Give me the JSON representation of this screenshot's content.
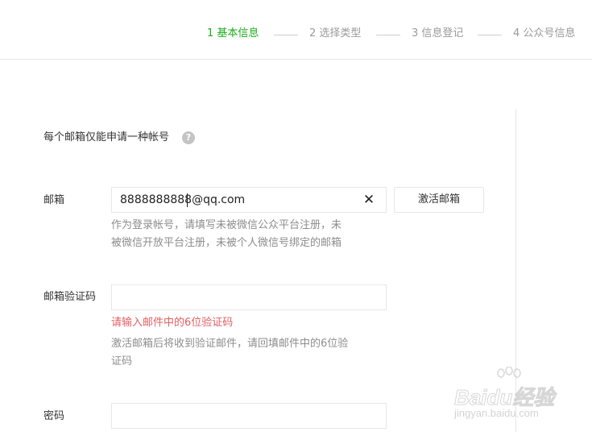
{
  "steps": [
    {
      "label": "1 基本信息",
      "active": true
    },
    {
      "label": "2 选择类型",
      "active": false
    },
    {
      "label": "3 信息登记",
      "active": false
    },
    {
      "label": "4 公众号信息",
      "active": false
    }
  ],
  "notice": {
    "text": "每个邮箱仅能申请一种帐号",
    "help_icon": "?"
  },
  "form": {
    "email": {
      "label": "邮箱",
      "value": "8888888888@qq.com",
      "clear_icon": "✕",
      "activate_button": "激活邮箱",
      "tip_line1": "作为登录帐号，请填写未被微信公众平台注册，未",
      "tip_line2": "被微信开放平台注册，未被个人微信号绑定的邮箱"
    },
    "verify_code": {
      "label": "邮箱验证码",
      "value": "",
      "error": "请输入邮件中的6位验证码",
      "tip_line1": "激活邮箱后将收到验证邮件，请回填邮件中的6位验",
      "tip_line2": "证码"
    },
    "password": {
      "label": "密码",
      "value": ""
    }
  },
  "watermark": {
    "main": "Baidu经验",
    "sub": "jingyan.baidu.com"
  },
  "colors": {
    "active_step": "#1aad19",
    "error": "#e15f63",
    "tip": "#8d8d8d",
    "border": "#e7e7eb"
  }
}
